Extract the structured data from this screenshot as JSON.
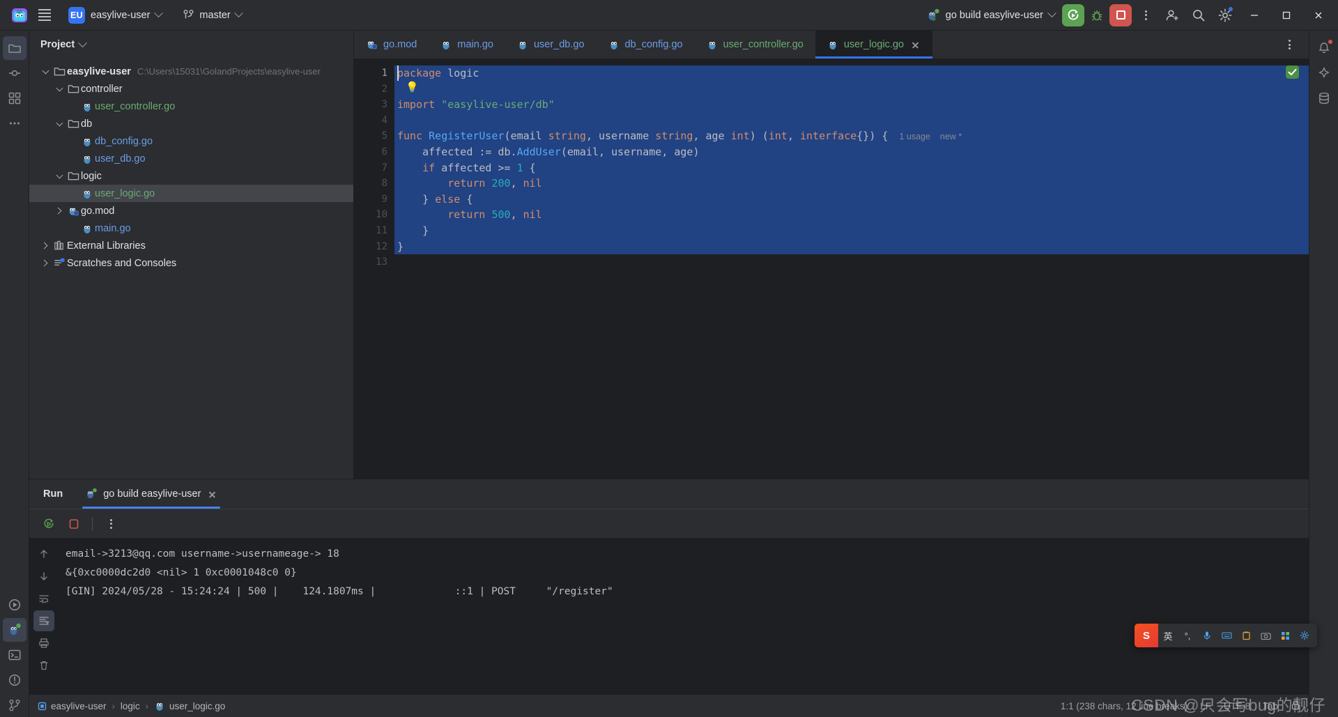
{
  "titlebar": {
    "menu_icon": "hamburger-icon",
    "product_icon": "goland-logo",
    "project_badge": "EU",
    "project_name": "easylive-user",
    "vcs_branch": "master",
    "run_config": "go build easylive-user",
    "buttons": {
      "run": "run-icon",
      "debug": "debug-icon",
      "stop": "stop-icon",
      "more": "more-vertical-icon",
      "account": "account-icon",
      "search": "search-icon",
      "settings": "settings-icon",
      "minimize": "minimize-icon",
      "maximize": "maximize-icon",
      "close": "close-icon"
    }
  },
  "left_toolstrip": [
    {
      "name": "project-tool-button",
      "icon": "folder-icon",
      "active": true
    },
    {
      "name": "commit-tool-button",
      "icon": "commit-icon",
      "active": false
    },
    {
      "name": "structure-tool-button",
      "icon": "structure-icon",
      "active": false
    },
    {
      "name": "more-tool-button",
      "icon": "more-horizontal-icon",
      "active": false
    }
  ],
  "left_toolstrip_bottom": [
    {
      "name": "run-tool-button",
      "icon": "run-outline-icon"
    },
    {
      "name": "run-anything-button",
      "icon": "run-debug-icon",
      "active": true
    },
    {
      "name": "terminal-tool-button",
      "icon": "terminal-icon"
    },
    {
      "name": "problems-tool-button",
      "icon": "problems-icon"
    },
    {
      "name": "vcs-tool-button",
      "icon": "branch-icon"
    }
  ],
  "right_toolstrip": [
    {
      "name": "notifications-tool-button",
      "icon": "bell-icon"
    },
    {
      "name": "ai-assistant-tool-button",
      "icon": "ai-icon"
    },
    {
      "name": "database-tool-button",
      "icon": "database-icon"
    }
  ],
  "project_panel": {
    "title": "Project",
    "tree": [
      {
        "label": "easylive-user",
        "path": "C:\\Users\\15031\\GolandProjects\\easylive-user",
        "indent": 0,
        "arrow": "open",
        "icon": "folder-icon",
        "style": "bold",
        "selected": false
      },
      {
        "label": "controller",
        "path": "",
        "indent": 1,
        "arrow": "open",
        "icon": "folder-icon",
        "style": "plain",
        "selected": false
      },
      {
        "label": "user_controller.go",
        "path": "",
        "indent": 2,
        "arrow": "none",
        "icon": "go-file-icon",
        "style": "go-green",
        "selected": false
      },
      {
        "label": "db",
        "path": "",
        "indent": 1,
        "arrow": "open",
        "icon": "folder-icon",
        "style": "plain",
        "selected": false
      },
      {
        "label": "db_config.go",
        "path": "",
        "indent": 2,
        "arrow": "none",
        "icon": "go-file-icon",
        "style": "go",
        "selected": false
      },
      {
        "label": "user_db.go",
        "path": "",
        "indent": 2,
        "arrow": "none",
        "icon": "go-file-icon",
        "style": "go",
        "selected": false
      },
      {
        "label": "logic",
        "path": "",
        "indent": 1,
        "arrow": "open",
        "icon": "folder-icon",
        "style": "plain",
        "selected": false
      },
      {
        "label": "user_logic.go",
        "path": "",
        "indent": 2,
        "arrow": "none",
        "icon": "go-file-icon",
        "style": "go-green",
        "selected": true
      },
      {
        "label": "go.mod",
        "path": "",
        "indent": 1,
        "arrow": "closed",
        "icon": "go-mod-icon",
        "style": "plain",
        "selected": false
      },
      {
        "label": "main.go",
        "path": "",
        "indent": 2,
        "arrow": "none",
        "icon": "go-file-icon",
        "style": "go",
        "selected": false
      },
      {
        "label": "External Libraries",
        "path": "",
        "indent": 0,
        "arrow": "closed",
        "icon": "library-icon",
        "style": "plain",
        "selected": false
      },
      {
        "label": "Scratches and Consoles",
        "path": "",
        "indent": 0,
        "arrow": "closed",
        "icon": "scratches-icon",
        "style": "plain",
        "selected": false
      }
    ]
  },
  "editor": {
    "tabs": [
      {
        "label": "go.mod",
        "color": "blue",
        "active": false,
        "icon": "go-mod-icon"
      },
      {
        "label": "main.go",
        "color": "blue",
        "active": false,
        "icon": "go-file-icon"
      },
      {
        "label": "user_db.go",
        "color": "blue",
        "active": false,
        "icon": "go-file-icon"
      },
      {
        "label": "db_config.go",
        "color": "blue",
        "active": false,
        "icon": "go-file-icon"
      },
      {
        "label": "user_controller.go",
        "color": "green",
        "active": false,
        "icon": "go-file-icon"
      },
      {
        "label": "user_logic.go",
        "color": "green",
        "active": true,
        "icon": "go-file-icon"
      }
    ],
    "tab_options_icon": "more-vertical-icon",
    "inspection_status": "ok-check-icon",
    "gutter_bulb": "intention-bulb-icon",
    "line_numbers": [
      "1",
      "2",
      "3",
      "4",
      "5",
      "6",
      "7",
      "8",
      "9",
      "10",
      "11",
      "12",
      "13"
    ],
    "inlay_hint": "1 usage",
    "inlay_hint_2": "new *",
    "lines": [
      {
        "n": 1,
        "text": "package logic",
        "selected": true
      },
      {
        "n": 2,
        "text": "",
        "selected": true
      },
      {
        "n": 3,
        "text": "import \"easylive-user/db\"",
        "selected": true
      },
      {
        "n": 4,
        "text": "",
        "selected": true
      },
      {
        "n": 5,
        "text": "func RegisterUser(email string, username string, age int) (int, interface{}) {",
        "selected": true
      },
      {
        "n": 6,
        "text": "    affected := db.AddUser(email, username, age)",
        "selected": true
      },
      {
        "n": 7,
        "text": "    if affected >= 1 {",
        "selected": true
      },
      {
        "n": 8,
        "text": "        return 200, nil",
        "selected": true
      },
      {
        "n": 9,
        "text": "    } else {",
        "selected": true
      },
      {
        "n": 10,
        "text": "        return 500, nil",
        "selected": true
      },
      {
        "n": 11,
        "text": "    }",
        "selected": true
      },
      {
        "n": 12,
        "text": "}",
        "selected": true
      },
      {
        "n": 13,
        "text": "",
        "selected": false
      }
    ]
  },
  "run_panel": {
    "title": "Run",
    "tab_label": "go build easylive-user",
    "tab_icon": "go-run-icon",
    "tab_close_icon": "close-icon",
    "toolbar": {
      "rerun": "rerun-icon",
      "stop": "stop-icon",
      "more": "more-vertical-icon"
    },
    "side_buttons": [
      {
        "name": "scroll-up-button",
        "icon": "arrow-up-icon"
      },
      {
        "name": "scroll-down-button",
        "icon": "arrow-down-icon"
      },
      {
        "name": "soft-wrap-button",
        "icon": "soft-wrap-icon"
      },
      {
        "name": "scroll-to-end-button",
        "icon": "scroll-end-icon",
        "active": true
      },
      {
        "name": "print-button",
        "icon": "print-icon"
      },
      {
        "name": "clear-all-button",
        "icon": "trash-icon"
      }
    ],
    "console_lines": [
      "email->3213@qq.com username->usernameage-> 18",
      "&{0xc0000dc2d0 <nil> 1 0xc0001048c0 0}",
      "[GIN] 2024/05/28 - 15:24:24 | 500 |    124.1807ms |             ::1 | POST     \"/register\""
    ]
  },
  "status_bar": {
    "breadcrumbs": [
      "easylive-user",
      "logic",
      "user_logic.go"
    ],
    "caret_position": "1:1 (238 chars, 12 line breaks)",
    "line_separator": "LF",
    "encoding": "UTF-8",
    "indent": "Tab",
    "lock_icon": "lock-icon"
  },
  "ime_bar": {
    "logo": "S",
    "mode": "英",
    "items": [
      "voice-icon",
      "keyboard-icon",
      "clipboard-icon",
      "screenshot-icon",
      "apps-icon",
      "settings-icon"
    ]
  },
  "watermark": "CSDN @只会写bug的靓仔",
  "colors": {
    "accent": "#3574f0",
    "run_green": "#5ba352",
    "stop_red": "#d0554f",
    "selection": "#214283",
    "panel_bg": "#2b2d30",
    "editor_bg": "#1e1f22"
  }
}
